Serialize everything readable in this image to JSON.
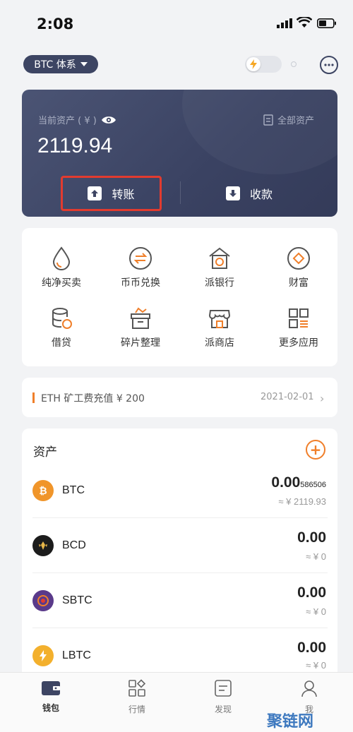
{
  "status_bar": {
    "time": "2:08"
  },
  "header": {
    "system_selector": "BTC 体系"
  },
  "asset_card": {
    "label": "当前资产 ( ¥ )",
    "all_assets": "全部资产",
    "balance": "2119.94",
    "transfer": "转账",
    "receive": "收款"
  },
  "features": [
    {
      "label": "纯净买卖",
      "icon": "droplet-icon"
    },
    {
      "label": "币币兑换",
      "icon": "exchange-icon"
    },
    {
      "label": "派银行",
      "icon": "bank-icon"
    },
    {
      "label": "财富",
      "icon": "diamond-icon"
    },
    {
      "label": "借贷",
      "icon": "database-icon"
    },
    {
      "label": "碎片整理",
      "icon": "box-icon"
    },
    {
      "label": "派商店",
      "icon": "store-icon"
    },
    {
      "label": "更多应用",
      "icon": "apps-icon"
    }
  ],
  "notice": {
    "text": "ETH 矿工费充值 ¥ 200",
    "date": "2021-02-01"
  },
  "assets": {
    "title": "资产",
    "rows": [
      {
        "symbol": "BTC",
        "amount_main": "0.00",
        "amount_tail": "586506",
        "fiat": "≈ ¥ 2119.93",
        "color": "#f0952a"
      },
      {
        "symbol": "BCD",
        "amount_main": "0.00",
        "amount_tail": "",
        "fiat": "≈ ¥ 0",
        "color": "#1c1c1c"
      },
      {
        "symbol": "SBTC",
        "amount_main": "0.00",
        "amount_tail": "",
        "fiat": "≈ ¥ 0",
        "color": "#5a3a8a"
      },
      {
        "symbol": "LBTC",
        "amount_main": "0.00",
        "amount_tail": "",
        "fiat": "≈ ¥ 0",
        "color": "#f3b02d"
      }
    ]
  },
  "nav": [
    {
      "label": "钱包",
      "icon": "wallet-icon",
      "active": true
    },
    {
      "label": "行情",
      "icon": "market-icon",
      "active": false
    },
    {
      "label": "发现",
      "icon": "discover-icon",
      "active": false
    },
    {
      "label": "我",
      "icon": "profile-icon",
      "active": false
    }
  ],
  "watermark": "聚链网"
}
